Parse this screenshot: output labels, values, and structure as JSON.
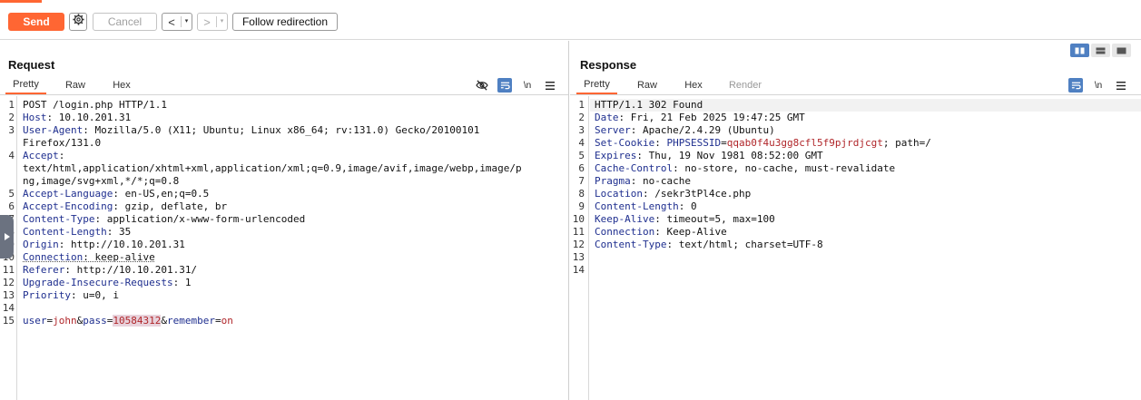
{
  "toolbar": {
    "send_label": "Send",
    "cancel_label": "Cancel",
    "back_arrow": "<",
    "forward_arrow": ">",
    "dropdown_glyph": "▾",
    "follow_label": "Follow redirection",
    "icons": {
      "settings": "gear-icon"
    }
  },
  "colors": {
    "accent": "#ff6633",
    "selected_icon": "#4f80c2",
    "header_key": "#1f2f8f",
    "param_value": "#b0262a"
  },
  "request": {
    "title": "Request",
    "tabs": [
      "Pretty",
      "Raw",
      "Hex"
    ],
    "active_tab": "Pretty",
    "tool_icons": [
      "eye-slash-icon",
      "wrap-icon",
      "newline-toggle",
      "menu-icon"
    ],
    "newline_label": "\\n",
    "lines": [
      {
        "n": "1",
        "plain": "POST /login.php HTTP/1.1"
      },
      {
        "n": "2",
        "key": "Host",
        "value": " 10.10.201.31"
      },
      {
        "n": "3",
        "key": "User-Agent",
        "value": " Mozilla/5.0 (X11; Ubuntu; Linux x86_64; rv:131.0) Gecko/20100101"
      },
      {
        "n": "",
        "plain": "Firefox/131.0"
      },
      {
        "n": "4",
        "key": "Accept",
        "value": ""
      },
      {
        "n": "",
        "plain": "text/html,application/xhtml+xml,application/xml;q=0.9,image/avif,image/webp,image/p"
      },
      {
        "n": "",
        "plain": "ng,image/svg+xml,*/*;q=0.8"
      },
      {
        "n": "5",
        "key": "Accept-Language",
        "value": " en-US,en;q=0.5"
      },
      {
        "n": "6",
        "key": "Accept-Encoding",
        "value": " gzip, deflate, br"
      },
      {
        "n": "7",
        "key": "Content-Type",
        "value": " application/x-www-form-urlencoded"
      },
      {
        "n": "8",
        "key": "Content-Length",
        "value": " 35"
      },
      {
        "n": "9",
        "key": "Origin",
        "value": " http://10.10.201.31"
      },
      {
        "n": "10",
        "key": "Connection",
        "value": " keep-alive"
      },
      {
        "n": "11",
        "key": "Referer",
        "value": " http://10.10.201.31/"
      },
      {
        "n": "12",
        "key": "Upgrade-Insecure-Requests",
        "value": " 1"
      },
      {
        "n": "13",
        "key": "Priority",
        "value": " u=0, i"
      },
      {
        "n": "14",
        "plain": ""
      },
      {
        "n": "15",
        "body": [
          {
            "t": "pk",
            "s": "user"
          },
          {
            "t": "eq",
            "s": "="
          },
          {
            "t": "pv",
            "s": "john"
          },
          {
            "t": "eq",
            "s": "&"
          },
          {
            "t": "pk",
            "s": "pass"
          },
          {
            "t": "eq",
            "s": "="
          },
          {
            "t": "pvhl",
            "s": "10584312"
          },
          {
            "t": "eq",
            "s": "&"
          },
          {
            "t": "pk",
            "s": "remember"
          },
          {
            "t": "eq",
            "s": "="
          },
          {
            "t": "pv",
            "s": "on"
          }
        ]
      }
    ]
  },
  "response": {
    "title": "Response",
    "tabs": [
      "Pretty",
      "Raw",
      "Hex",
      "Render"
    ],
    "active_tab": "Pretty",
    "tool_icons": [
      "wrap-icon",
      "newline-toggle",
      "menu-icon"
    ],
    "newline_label": "\\n",
    "view_modes": [
      "split-horizontal-icon",
      "split-vertical-icon",
      "single-pane-icon"
    ],
    "lines": [
      {
        "n": "1",
        "plain": "HTTP/1.1 302 Found"
      },
      {
        "n": "2",
        "key": "Date",
        "value": " Fri, 21 Feb 2025 19:47:25 GMT"
      },
      {
        "n": "3",
        "key": "Server",
        "value": " Apache/2.4.29 (Ubuntu)"
      },
      {
        "n": "4",
        "key": "Set-Cookie",
        "value": " ",
        "cookie_name": "PHPSESSID",
        "cookie_value": "qqab0f4u3gg8cfl5f9pjrdjcgt",
        "rest": "; path=/"
      },
      {
        "n": "5",
        "key": "Expires",
        "value": " Thu, 19 Nov 1981 08:52:00 GMT"
      },
      {
        "n": "6",
        "key": "Cache-Control",
        "value": " no-store, no-cache, must-revalidate"
      },
      {
        "n": "7",
        "key": "Pragma",
        "value": " no-cache"
      },
      {
        "n": "8",
        "key": "Location",
        "value": " /sekr3tPl4ce.php"
      },
      {
        "n": "9",
        "key": "Content-Length",
        "value": " 0"
      },
      {
        "n": "10",
        "key": "Keep-Alive",
        "value": " timeout=5, max=100"
      },
      {
        "n": "11",
        "key": "Connection",
        "value": " Keep-Alive"
      },
      {
        "n": "12",
        "key": "Content-Type",
        "value": " text/html; charset=UTF-8"
      },
      {
        "n": "13",
        "plain": ""
      },
      {
        "n": "14",
        "plain": ""
      }
    ]
  }
}
